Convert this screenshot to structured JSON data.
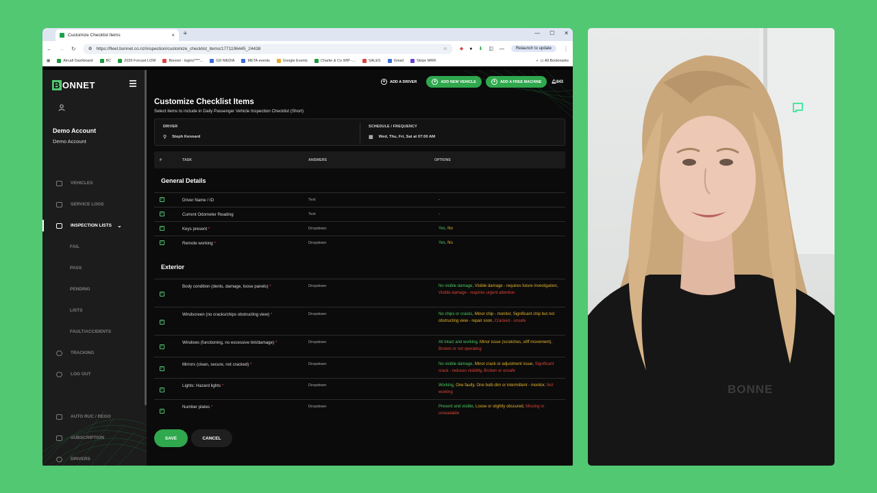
{
  "browser": {
    "tab_title": "Customize Checklist Items",
    "url": "https://fleet.bonnet.co.nz/inspection/customize_checklist_items/1771196445_24438",
    "relaunch_label": "Relaunch to update",
    "bookmarks": [
      "Aircall Dashboard",
      "BC",
      "2026 Forcast LOW",
      "Bonnet - logins****...",
      "GD MEDIA",
      "META events",
      "Google Events",
      "Charlie & Co WIP -...",
      "SALES",
      "Gmail",
      "Stripe MRR"
    ],
    "all_bookmarks": "All Bookmarks"
  },
  "sidebar": {
    "logo_b": "B",
    "logo_rest": "ONNET",
    "account_name": "Demo Account",
    "account_sub": "Demo Account",
    "nav": {
      "vehicles": "VEHICLES",
      "service_logs": "SERVICE LOGS",
      "inspection_lists": "INSPECTION LISTS",
      "fail": "FAIL",
      "pass": "PASS",
      "pending": "PENDING",
      "lists": "LISTS",
      "fault": "FAULT/ACCIDENTS",
      "tracking": "TRACKING",
      "logout": "LOG OUT",
      "auto_ruc": "AUTO RUC / REGO",
      "subscription": "SUBSCRIPTION",
      "drivers": "DRIVERS"
    }
  },
  "topbar": {
    "add_driver": "ADD A DRIVER",
    "add_vehicle": "ADD NEW VEHICLE",
    "add_machine": "ADD A FREE MACHINE",
    "notif_count": "843"
  },
  "page": {
    "title": "Customize Checklist Items",
    "subtitle": "Select items to include in Daily Passenger Vehicle Inspection Checklist (Short)",
    "driver_label": "DRIVER",
    "driver_value": "Steph Kennard",
    "schedule_label": "SCHEDULE / FREQUENCY",
    "schedule_value": "Wed, Thu, Fri, Sat at 07:00 AM"
  },
  "table": {
    "headers": {
      "num": "#",
      "task": "TASK",
      "answers": "ANSWERS",
      "options": "OPTIONS"
    },
    "sections": [
      "General Details",
      "Exterior"
    ],
    "rows": [
      {
        "task": "Driver Name / ID",
        "req": "",
        "answer": "Text",
        "opt": [
          [
            "-",
            "d"
          ]
        ]
      },
      {
        "task": "Current Odometer Reading",
        "req": "",
        "answer": "Text",
        "opt": [
          [
            "-",
            "d"
          ]
        ]
      },
      {
        "task": "Keys present",
        "req": "*",
        "answer": "Dropdown",
        "opt": [
          [
            "Yes",
            "g"
          ],
          [
            ", ",
            "d"
          ],
          [
            "No",
            "y"
          ]
        ]
      },
      {
        "task": "Remote working",
        "req": "*",
        "answer": "Dropdown",
        "opt": [
          [
            "Yes",
            "g"
          ],
          [
            ", ",
            "d"
          ],
          [
            "No",
            "y"
          ]
        ]
      },
      {
        "task": "Body condition (dents, damage, loose panels)",
        "req": "*",
        "answer": "Dropdown",
        "opt": [
          [
            "No visible damage",
            "g"
          ],
          [
            ", ",
            "d"
          ],
          [
            "Visible damage - requires future investigation",
            "y"
          ],
          [
            ", ",
            "d"
          ],
          [
            "Visible damage - requires urgent attention",
            "r"
          ]
        ]
      },
      {
        "task": "Windscreen (no cracks/chips obstructing view)",
        "req": "*",
        "answer": "Dropdown",
        "opt": [
          [
            "No chips or cracks",
            "g"
          ],
          [
            ", ",
            "d"
          ],
          [
            "Minor chip - monitor",
            "y"
          ],
          [
            ", ",
            "d"
          ],
          [
            "Significant chip but not obstructing view - repair soon",
            "y"
          ],
          [
            ", ",
            "d"
          ],
          [
            "Cracked - unsafe",
            "r"
          ]
        ]
      },
      {
        "task": "Windows (functioning, no excessive tint/damage)",
        "req": "*",
        "answer": "Dropdown",
        "opt": [
          [
            "All intact and working",
            "g"
          ],
          [
            ", ",
            "d"
          ],
          [
            "Minor issue (scratches, stiff movement)",
            "y"
          ],
          [
            ", ",
            "d"
          ],
          [
            "Broken or not operating",
            "r"
          ]
        ]
      },
      {
        "task": "Mirrors (clean, secure, not cracked)",
        "req": "*",
        "answer": "Dropdown",
        "opt": [
          [
            "No visible damage",
            "g"
          ],
          [
            ", ",
            "d"
          ],
          [
            "Minor crack or adjustment issue",
            "y"
          ],
          [
            ", ",
            "d"
          ],
          [
            "Significant crack - reduces visibility",
            "r"
          ],
          [
            ", ",
            "d"
          ],
          [
            "Broken or unsafe",
            "r"
          ]
        ]
      },
      {
        "task": "Lights: Hazard lights",
        "req": "*",
        "answer": "Dropdown",
        "opt": [
          [
            "Working",
            "g"
          ],
          [
            ", ",
            "d"
          ],
          [
            "One faulty",
            "y"
          ],
          [
            ", ",
            "d"
          ],
          [
            "One bulb dim or intermittent - monitor",
            "y"
          ],
          [
            ", ",
            "d"
          ],
          [
            "Not working",
            "r"
          ]
        ]
      },
      {
        "task": "Number plates",
        "req": "*",
        "answer": "Dropdown",
        "opt": [
          [
            "Present and visible",
            "g"
          ],
          [
            ", ",
            "d"
          ],
          [
            "Loose or slightly obscured",
            "y"
          ],
          [
            ", ",
            "d"
          ],
          [
            "Missing or unreadable",
            "r"
          ]
        ]
      }
    ]
  },
  "actions": {
    "save": "SAVE",
    "cancel": "CANCEL"
  },
  "webcam": {
    "shirt_text": "BONNE"
  },
  "colors": {
    "accent": "#2fa84e",
    "background": "#52c873",
    "ok": "#4ccb61",
    "warn": "#e8b630",
    "bad": "#e0443a"
  }
}
